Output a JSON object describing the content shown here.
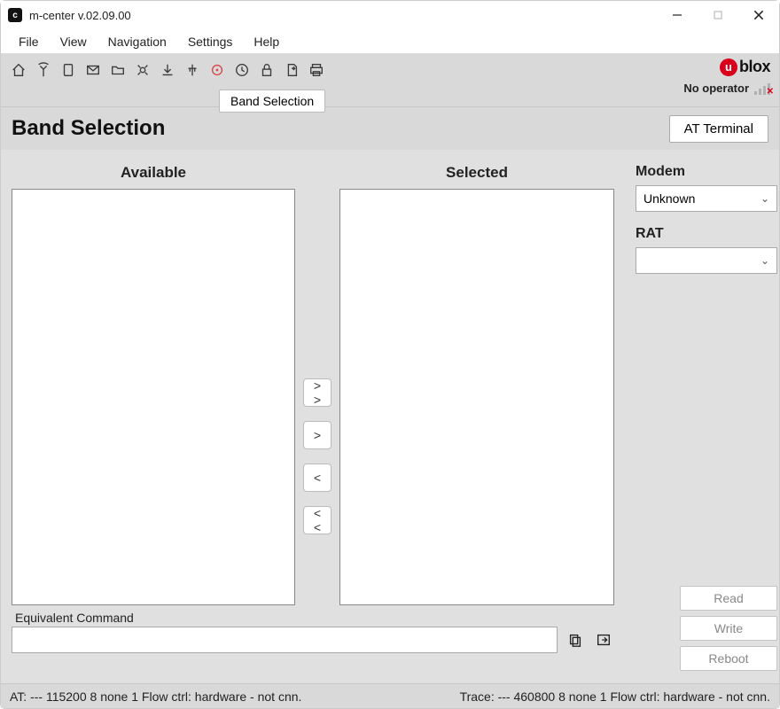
{
  "window": {
    "title": "m-center v.02.09.00"
  },
  "menu": {
    "file": "File",
    "view": "View",
    "navigation": "Navigation",
    "settings": "Settings",
    "help": "Help"
  },
  "toolbar": {
    "tooltip": "Band Selection"
  },
  "brand": {
    "logo_text": "blox",
    "operator": "No operator"
  },
  "header": {
    "page_title": "Band Selection",
    "at_terminal": "AT Terminal"
  },
  "panels": {
    "available_label": "Available",
    "selected_label": "Selected",
    "move_all_right": "> >",
    "move_right": ">",
    "move_left": "<",
    "move_all_left": "< <"
  },
  "equivalent": {
    "label": "Equivalent Command",
    "value": ""
  },
  "side": {
    "modem_label": "Modem",
    "modem_value": "Unknown",
    "rat_label": "RAT",
    "rat_value": ""
  },
  "actions": {
    "read": "Read",
    "write": "Write",
    "reboot": "Reboot"
  },
  "status": {
    "left": "AT: --- 115200 8 none 1 Flow ctrl: hardware - not cnn.",
    "right": "Trace: --- 460800 8 none 1 Flow ctrl: hardware - not cnn."
  }
}
